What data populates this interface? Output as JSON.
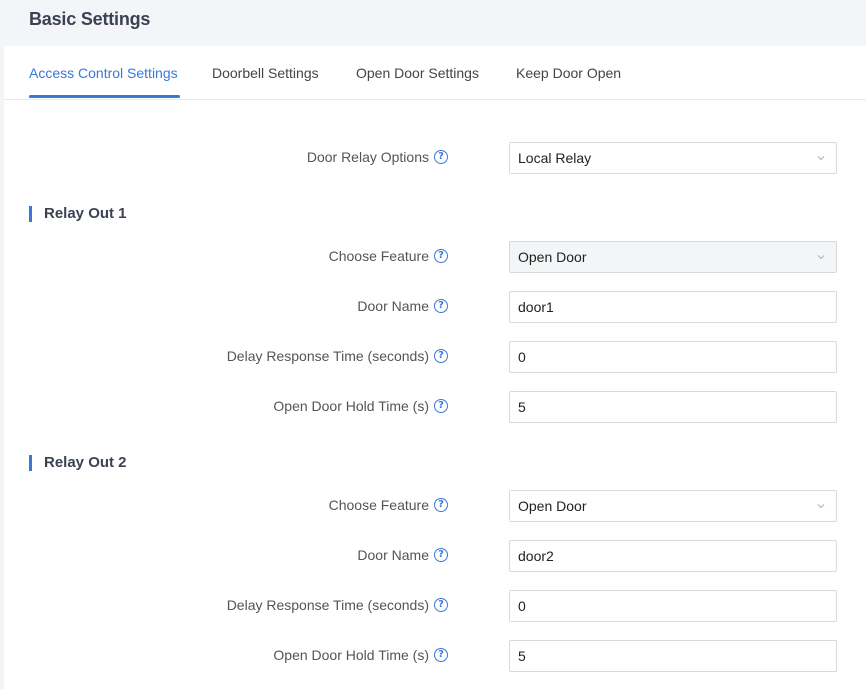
{
  "page": {
    "title": "Basic Settings"
  },
  "tabs": [
    {
      "label": "Access Control Settings",
      "active": true
    },
    {
      "label": "Doorbell Settings"
    },
    {
      "label": "Open Door Settings"
    },
    {
      "label": "Keep Door Open"
    }
  ],
  "door_relay": {
    "label": "Door Relay Options",
    "value": "Local Relay"
  },
  "relay1": {
    "title": "Relay Out 1",
    "feature_label": "Choose Feature",
    "feature_value": "Open Door",
    "name_label": "Door Name",
    "name_value": "door1",
    "delay_label": "Delay Response Time (seconds)",
    "delay_value": "0",
    "hold_label": "Open Door Hold Time (s)",
    "hold_value": "5"
  },
  "relay2": {
    "title": "Relay Out 2",
    "feature_label": "Choose Feature",
    "feature_value": "Open Door",
    "name_label": "Door Name",
    "name_value": "door2",
    "delay_label": "Delay Response Time (seconds)",
    "delay_value": "0",
    "hold_label": "Open Door Hold Time (s)",
    "hold_value": "5"
  },
  "icons": {
    "help": "question-circle-icon",
    "dropdown": "chevron-down-icon"
  },
  "help_glyph": "?",
  "colors": {
    "accent": "#3a78d6",
    "background": "#f3f5f8",
    "card": "#ffffff"
  }
}
